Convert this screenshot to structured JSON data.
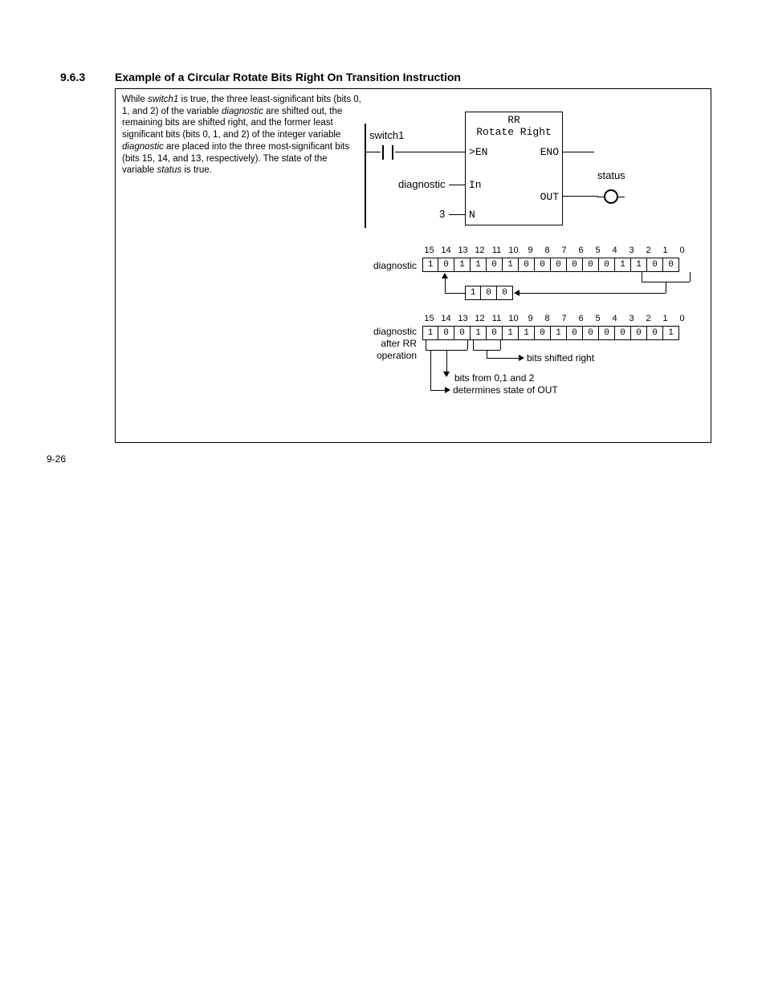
{
  "section_number": "9.6.3",
  "section_title": "Example of a Circular Rotate Bits Right On Transition Instruction",
  "page_number": "9-26",
  "description": {
    "p1a": "While ",
    "p1b": "switch1",
    "p1c": " is true, the three least-significant bits (bits 0, 1, and 2) of the variable ",
    "p1d": "diagnostic",
    "p1e": " are shifted out, the remaining bits are shifted right, and the former least significant bits (bits 0, 1, and 2) of the integer variable ",
    "p1f": "diagnostic",
    "p1g": " are placed into the three most-significant bits (bits 15, 14, and 13, respectively). The state of the variable ",
    "p1h": "status",
    "p1i": " is true."
  },
  "ladder": {
    "switch1": "switch1",
    "diagnostic": "diagnostic",
    "n_value": "3",
    "status": "status",
    "fb_code": "RR",
    "fb_name": "Rotate Right",
    "port_en": "EN",
    "port_in": "In",
    "port_n": "N",
    "port_eno": "ENO",
    "port_out": "OUT"
  },
  "bits": {
    "label_before": "diagnostic",
    "label_after_l1": "diagnostic",
    "label_after_l2": "after RR",
    "label_after_l3": "operation",
    "numbers": [
      "15",
      "14",
      "13",
      "12",
      "11",
      "10",
      "9",
      "8",
      "7",
      "6",
      "5",
      "4",
      "3",
      "2",
      "1",
      "0"
    ],
    "row_before": [
      "1",
      "0",
      "1",
      "1",
      "0",
      "1",
      "0",
      "0",
      "0",
      "0",
      "0",
      "0",
      "1",
      "1",
      "0",
      "0"
    ],
    "carry": [
      "1",
      "0",
      "0"
    ],
    "row_after": [
      "1",
      "0",
      "0",
      "1",
      "0",
      "1",
      "1",
      "0",
      "1",
      "0",
      "0",
      "0",
      "0",
      "0",
      "0",
      "1"
    ],
    "annot_shifted": "bits shifted right",
    "annot_from": "bits from 0,1 and 2",
    "annot_out": "determines state of OUT"
  }
}
